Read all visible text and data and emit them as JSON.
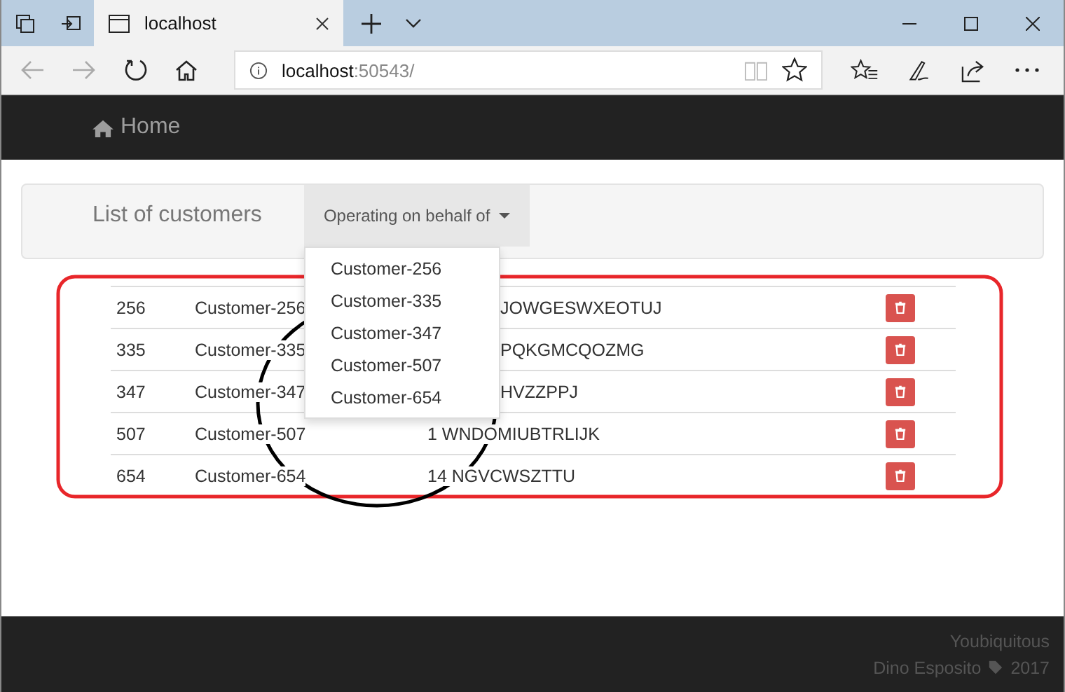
{
  "browser": {
    "tab_title": "localhost",
    "address_host": "localhost",
    "address_rest": ":50543/"
  },
  "navbar": {
    "brand": "Home"
  },
  "panel": {
    "title": "List of customers",
    "dropdown": {
      "label": "Operating on behalf of",
      "expanded": true,
      "items": [
        "Customer-256",
        "Customer-335",
        "Customer-347",
        "Customer-507",
        "Customer-654"
      ]
    }
  },
  "table": {
    "rows": [
      {
        "id": "256",
        "name": "Customer-256",
        "address": "JOWGESWXEOTUJ",
        "covered": true
      },
      {
        "id": "335",
        "name": "Customer-335",
        "address": "PQKGMCQOZMG",
        "covered": true
      },
      {
        "id": "347",
        "name": "Customer-347",
        "address": "HVZZPPJ",
        "covered": true
      },
      {
        "id": "507",
        "name": "Customer-507",
        "address": "1 WNDOMIUBTRLIJK",
        "covered": false
      },
      {
        "id": "654",
        "name": "Customer-654",
        "address": "14 NGVCWSZTTU",
        "covered": false
      }
    ]
  },
  "footer": {
    "line_1": "Youbiquitous",
    "author": "Dino Esposito",
    "year": "2017"
  }
}
